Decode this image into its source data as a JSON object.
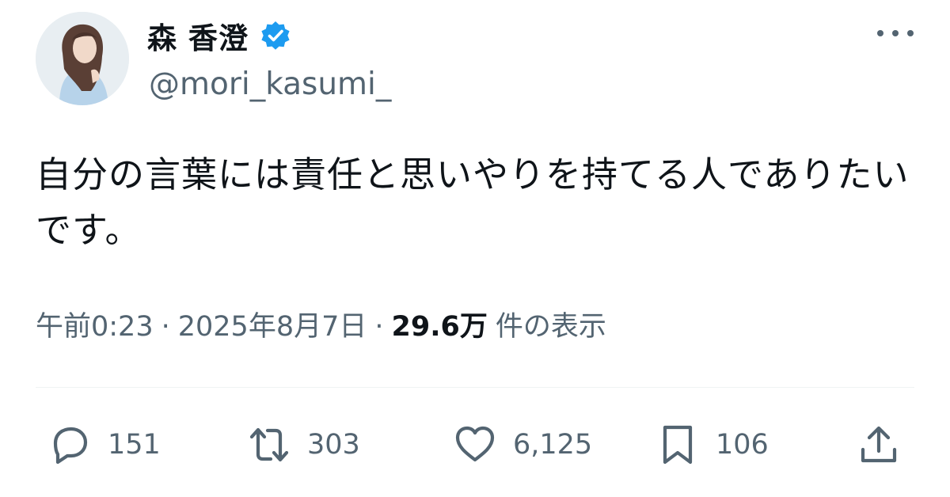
{
  "author": {
    "display_name": "森 香澄",
    "handle": "@mori_kasumi_",
    "verified": true,
    "avatar_icon": "profile-photo"
  },
  "tweet": {
    "text": "自分の言葉には責任と思いやりを持てる人でありたいです。"
  },
  "meta": {
    "time": "午前0:23",
    "separator": "·",
    "date": "2025年8月7日",
    "views_count": "29.6万",
    "views_label": "件の表示"
  },
  "actions": {
    "reply_count": "151",
    "retweet_count": "303",
    "like_count": "6,125",
    "bookmark_count": "106"
  },
  "colors": {
    "text": "#0f1419",
    "secondary": "#536471",
    "verified_blue": "#1d9bf0",
    "divider": "#eff3f4"
  }
}
